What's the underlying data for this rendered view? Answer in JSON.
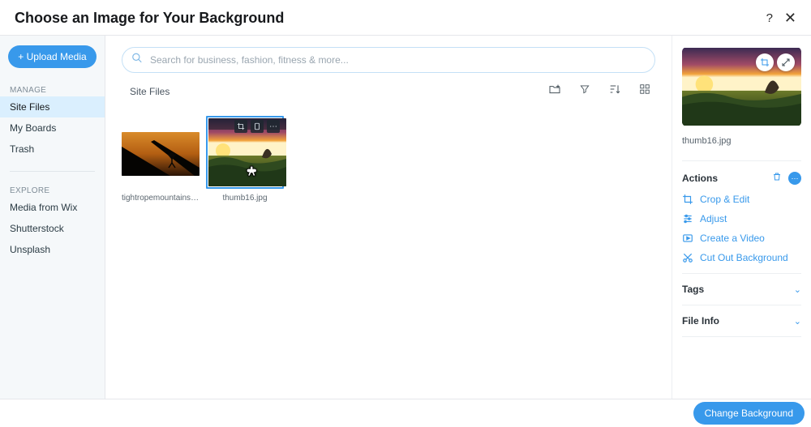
{
  "header": {
    "title": "Choose an Image for Your Background"
  },
  "sidebar": {
    "upload_label": "+ Upload Media",
    "manage_label": "MANAGE",
    "manage_items": [
      "Site Files",
      "My Boards",
      "Trash"
    ],
    "explore_label": "EXPLORE",
    "explore_items": [
      "Media from Wix",
      "Shutterstock",
      "Unsplash"
    ]
  },
  "search": {
    "placeholder": "Search for business, fashion, fitness & more..."
  },
  "toolbar": {
    "title": "Site Files"
  },
  "files": [
    {
      "name": "tightropemountains.jpg",
      "selected": false
    },
    {
      "name": "thumb16.jpg",
      "selected": true
    }
  ],
  "panel": {
    "filename": "thumb16.jpg",
    "actions_title": "Actions",
    "actions": [
      "Crop & Edit",
      "Adjust",
      "Create a Video",
      "Cut Out Background"
    ],
    "tags_title": "Tags",
    "fileinfo_title": "File Info"
  },
  "footer": {
    "button": "Change Background"
  }
}
